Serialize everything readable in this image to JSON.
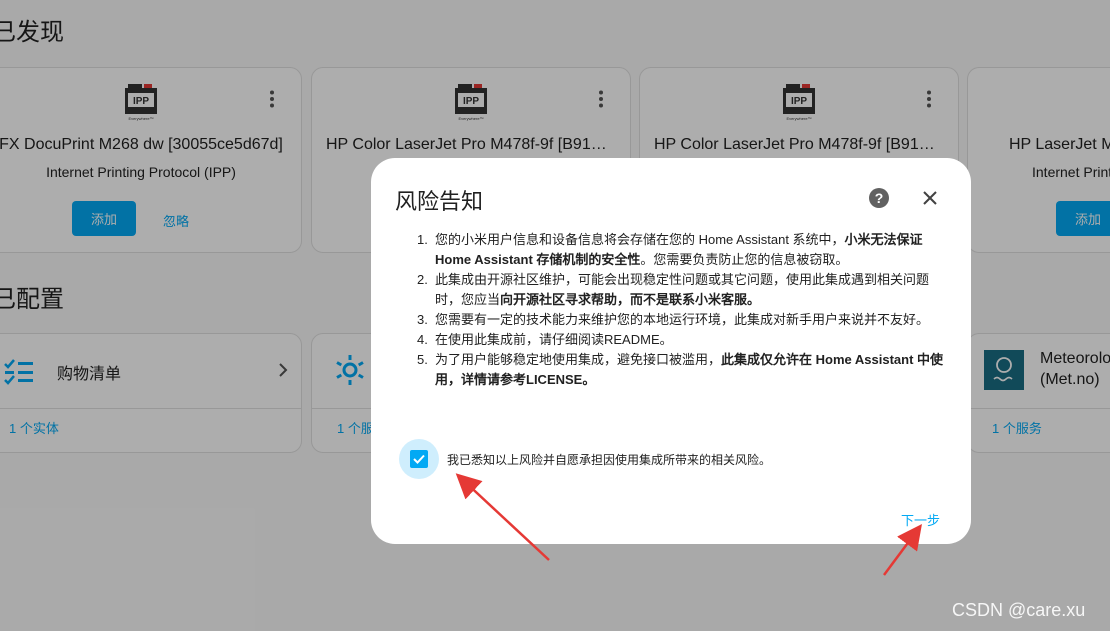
{
  "sections": {
    "discovered_title": "已发现",
    "configured_title": "已配置"
  },
  "discovered": [
    {
      "name": "FX DocuPrint M268 dw [30055ce5d67d]",
      "protocol": "Internet Printing Protocol (IPP)",
      "add_label": "添加",
      "ignore_label": "忽略"
    },
    {
      "name": "HP Color LaserJet Pro M478f-9f [B91F…",
      "protocol": ""
    },
    {
      "name": "HP Color LaserJet Pro M478f-9f [B91F…",
      "protocol": ""
    },
    {
      "name": "HP LaserJet M",
      "protocol": "Internet Printi",
      "add_label": "添加"
    }
  ],
  "configured": [
    {
      "label": "购物清单",
      "sub": "1 个实体"
    },
    {
      "label": "",
      "sub": "1 个服"
    },
    {
      "label": "Meteorolo",
      "label2": "(Met.no)",
      "sub": "1 个服务"
    }
  ],
  "dialog": {
    "title": "风险告知",
    "items": [
      {
        "num": "1.",
        "parts": [
          [
            "您的小米用户信息和设备信息将会存储在您的 Home Assistant 系统中，",
            false
          ],
          [
            "小米无法保证 Home Assistant 存储机制的安全性",
            true
          ],
          [
            "。您需要负责防止您的信息被窃取。",
            false
          ]
        ]
      },
      {
        "num": "2.",
        "parts": [
          [
            "此集成由开源社区维护，可能会出现稳定性问题或其它问题，使用此集成遇到相关问题时，您应当",
            false
          ],
          [
            "向开源社区寻求帮助，而不是联系小米客服。",
            true
          ]
        ]
      },
      {
        "num": "3.",
        "parts": [
          [
            "您需要有一定的技术能力来维护您的本地运行环境，此集成对新手用户来说并不友好。",
            false
          ]
        ]
      },
      {
        "num": "4.",
        "parts": [
          [
            "在使用此集成前，请仔细阅读README。",
            false
          ]
        ]
      },
      {
        "num": "5.",
        "parts": [
          [
            "为了用户能够稳定地使用集成，避免接口被滥用，",
            false
          ],
          [
            "此集成仅允许在 Home Assistant 中使用，详情请参考LICENSE。",
            true
          ]
        ]
      }
    ],
    "checkbox_label": "我已悉知以上风险并自愿承担因使用集成所带来的相关风险。",
    "checkbox_checked": true,
    "next_label": "下一步"
  },
  "watermark": "CSDN @care.xu",
  "colors": {
    "accent": "#03a9f4",
    "arrow": "#e53935"
  }
}
